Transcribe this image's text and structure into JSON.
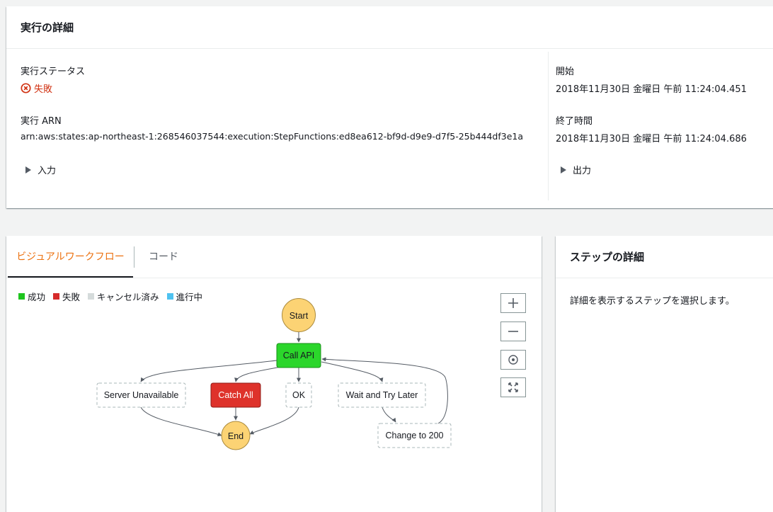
{
  "exec": {
    "title": "実行の詳細",
    "status_label": "実行ステータス",
    "status_value": "失敗",
    "arn_label": "実行 ARN",
    "arn_value": "arn:aws:states:ap-northeast-1:268546037544:execution:StepFunctions:ed8ea612-bf9d-d9e9-d7f5-25b444df3e1a",
    "input_label": "入力",
    "start_label": "開始",
    "start_value": "2018年11月30日 金曜日 午前 11:24:04.451",
    "end_label": "終了時間",
    "end_value": "2018年11月30日 金曜日 午前 11:24:04.686",
    "output_label": "出力"
  },
  "workflow": {
    "tabs": [
      "ビジュアルワークフロー",
      "コード"
    ],
    "legend": [
      {
        "label": "成功",
        "color": "#1ec51e"
      },
      {
        "label": "失敗",
        "color": "#d62b2b"
      },
      {
        "label": "キャンセル済み",
        "color": "#d5dbdb"
      },
      {
        "label": "進行中",
        "color": "#4ec2f0"
      }
    ],
    "zoom_controls": [
      "plus-icon",
      "minus-icon",
      "center-icon",
      "fit-icon"
    ],
    "nodes": {
      "start": "Start",
      "call_api": "Call API",
      "server_unavailable": "Server Unavailable",
      "catch_all": "Catch All",
      "ok": "OK",
      "wait_try_later": "Wait and Try Later",
      "change_200": "Change to 200",
      "end": "End"
    },
    "node_status": {
      "start": "terminal",
      "call_api": "succeeded",
      "catch_all": "failed",
      "server_unavailable": "not-run",
      "ok": "not-run",
      "wait_try_later": "not-run",
      "change_200": "not-run",
      "end": "terminal"
    },
    "colors": {
      "terminal": "#fcd374",
      "succeeded": "#2bd62b",
      "failed": "#de322b",
      "edge": "#545b64"
    }
  },
  "step_details": {
    "title": "ステップの詳細",
    "message": "詳細を表示するステップを選択します。"
  }
}
